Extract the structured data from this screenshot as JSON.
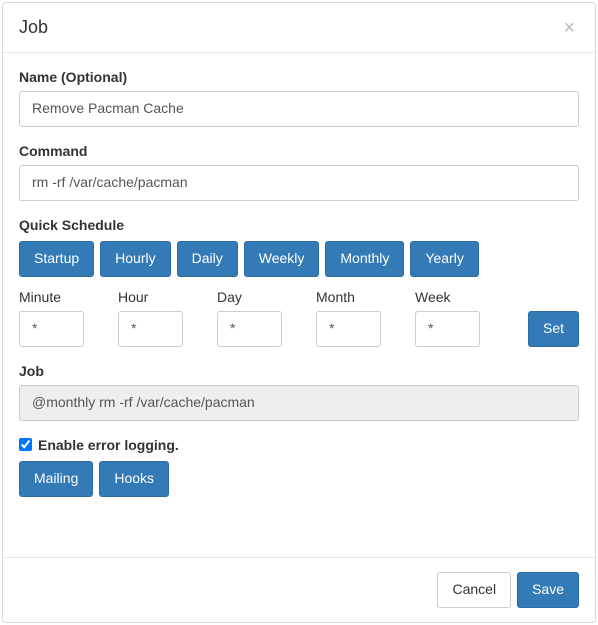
{
  "header": {
    "title": "Job",
    "close": "×"
  },
  "name": {
    "label": "Name (Optional)",
    "value": "Remove Pacman Cache"
  },
  "command": {
    "label": "Command",
    "value": "rm -rf /var/cache/pacman"
  },
  "quick_schedule": {
    "label": "Quick Schedule",
    "buttons": {
      "startup": "Startup",
      "hourly": "Hourly",
      "daily": "Daily",
      "weekly": "Weekly",
      "monthly": "Monthly",
      "yearly": "Yearly"
    }
  },
  "time_fields": {
    "minute": {
      "label": "Minute",
      "value": "*"
    },
    "hour": {
      "label": "Hour",
      "value": "*"
    },
    "day": {
      "label": "Day",
      "value": "*"
    },
    "month": {
      "label": "Month",
      "value": "*"
    },
    "week": {
      "label": "Week",
      "value": "*"
    },
    "set_button": "Set"
  },
  "job": {
    "label": "Job",
    "value": "@monthly rm -rf /var/cache/pacman"
  },
  "logging": {
    "label": "Enable error logging.",
    "checked": true
  },
  "action_buttons": {
    "mailing": "Mailing",
    "hooks": "Hooks"
  },
  "footer": {
    "cancel": "Cancel",
    "save": "Save"
  }
}
